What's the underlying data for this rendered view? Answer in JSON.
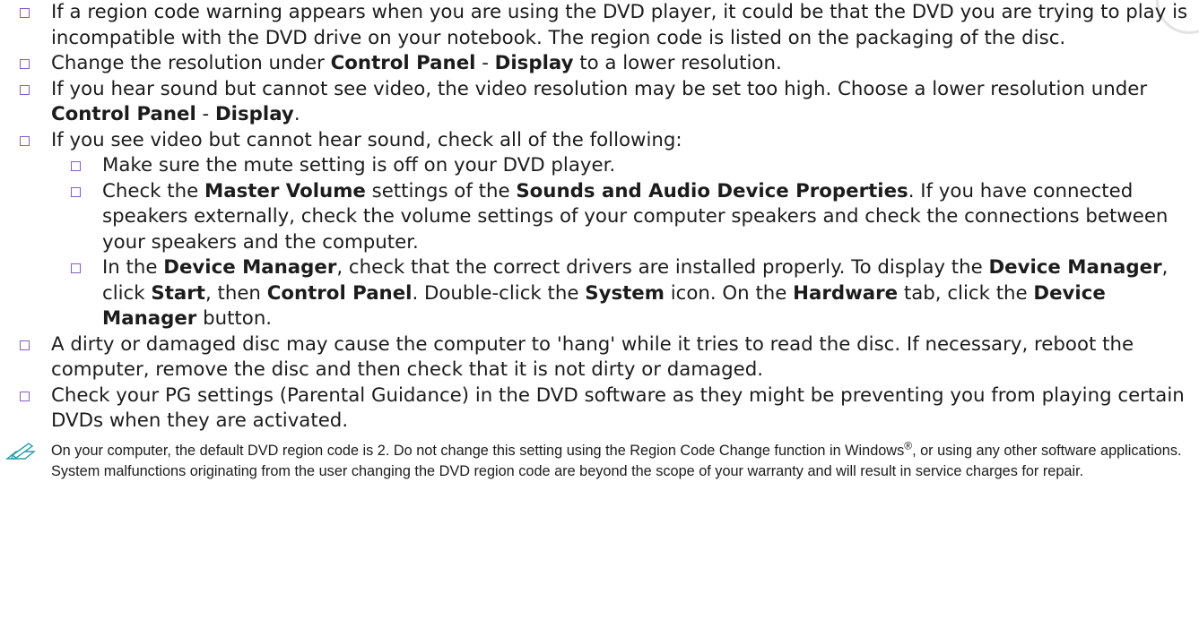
{
  "items": [
    {
      "segs": [
        {
          "t": "If a region code warning appears when you are using the DVD player, it could be that the DVD you are trying to play is incompatible with the DVD drive on your notebook. The region code is listed on the packaging of the disc.",
          "b": false
        }
      ]
    },
    {
      "segs": [
        {
          "t": "Change the resolution under ",
          "b": false
        },
        {
          "t": "Control Panel",
          "b": true
        },
        {
          "t": " - ",
          "b": false
        },
        {
          "t": "Display",
          "b": true
        },
        {
          "t": " to a lower resolution.",
          "b": false
        }
      ]
    },
    {
      "segs": [
        {
          "t": "If you hear sound but cannot see video, the video resolution may be set too high. Choose a lower resolution under ",
          "b": false
        },
        {
          "t": "Control Panel",
          "b": true
        },
        {
          "t": " - ",
          "b": false
        },
        {
          "t": "Display",
          "b": true
        },
        {
          "t": ".",
          "b": false
        }
      ]
    },
    {
      "segs": [
        {
          "t": "If you see video but cannot hear sound, check all of the following:",
          "b": false
        }
      ],
      "sub": [
        {
          "segs": [
            {
              "t": "Make sure the mute setting is off on your DVD player.",
              "b": false
            }
          ]
        },
        {
          "segs": [
            {
              "t": "Check the ",
              "b": false
            },
            {
              "t": "Master Volume",
              "b": true
            },
            {
              "t": " settings of the ",
              "b": false
            },
            {
              "t": "Sounds and Audio Device Properties",
              "b": true
            },
            {
              "t": ". If you have connected speakers externally, check the volume settings of your computer speakers and check the connections between your speakers and the computer.",
              "b": false
            }
          ]
        },
        {
          "segs": [
            {
              "t": "In the ",
              "b": false
            },
            {
              "t": "Device Manager",
              "b": true
            },
            {
              "t": ", check that the correct drivers are installed properly. To display the ",
              "b": false
            },
            {
              "t": "Device Manager",
              "b": true
            },
            {
              "t": ", click ",
              "b": false
            },
            {
              "t": "Start",
              "b": true
            },
            {
              "t": ", then ",
              "b": false
            },
            {
              "t": "Control Panel",
              "b": true
            },
            {
              "t": ". Double-click the ",
              "b": false
            },
            {
              "t": "System",
              "b": true
            },
            {
              "t": " icon. On the ",
              "b": false
            },
            {
              "t": "Hardware",
              "b": true
            },
            {
              "t": " tab, click the ",
              "b": false
            },
            {
              "t": "Device Manager",
              "b": true
            },
            {
              "t": " button.",
              "b": false
            }
          ]
        }
      ]
    },
    {
      "segs": [
        {
          "t": "A dirty or damaged disc may cause the computer to 'hang' while it tries to read the disc. If necessary, reboot the computer, remove the disc and then check that it is not dirty or damaged.",
          "b": false
        }
      ]
    },
    {
      "segs": [
        {
          "t": "Check your PG settings (Parental Guidance) in the DVD software as they might be preventing you from playing certain DVDs when they are activated.",
          "b": false
        }
      ]
    }
  ],
  "note": {
    "icon": "pencil-note-icon",
    "before": "On your computer, the default DVD region code is 2. Do not change this setting using the Region Code Change function in Windows",
    "sup": "®",
    "after": ", or using any other software applications. System malfunctions originating from the user changing the DVD region code are beyond the scope of your warranty and will result in service charges for repair."
  },
  "colors": {
    "bullet": "#8a5cc7",
    "note_icon": "#2a9fa8",
    "text": "#1c1c1c"
  }
}
